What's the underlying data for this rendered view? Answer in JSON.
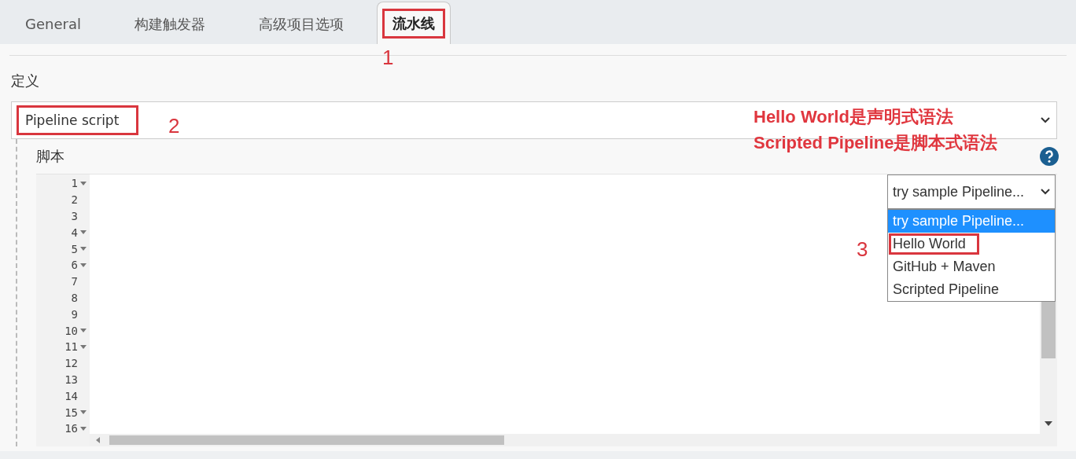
{
  "tabs": [
    {
      "label": "General",
      "selected": false,
      "highlighted": false
    },
    {
      "label": "构建触发器",
      "selected": false,
      "highlighted": false
    },
    {
      "label": "高级项目选项",
      "selected": false,
      "highlighted": false
    },
    {
      "label": "流水线",
      "selected": true,
      "highlighted": true
    }
  ],
  "definition": {
    "label": "定义",
    "value": "Pipeline script",
    "highlighted": true
  },
  "script": {
    "label": "脚本",
    "lines": [
      {
        "number": "1",
        "fold": true
      },
      {
        "number": "2",
        "fold": false
      },
      {
        "number": "3",
        "fold": false
      },
      {
        "number": "4",
        "fold": true
      },
      {
        "number": "5",
        "fold": true
      },
      {
        "number": "6",
        "fold": true
      },
      {
        "number": "7",
        "fold": false
      },
      {
        "number": "8",
        "fold": false
      },
      {
        "number": "9",
        "fold": false
      },
      {
        "number": "10",
        "fold": true
      },
      {
        "number": "11",
        "fold": true
      },
      {
        "number": "12",
        "fold": false
      },
      {
        "number": "13",
        "fold": false
      },
      {
        "number": "14",
        "fold": false
      },
      {
        "number": "15",
        "fold": true
      },
      {
        "number": "16",
        "fold": true
      }
    ],
    "sample_select": {
      "value": "try sample Pipeline...",
      "options": [
        {
          "label": "try sample Pipeline...",
          "selected": true,
          "highlighted": false
        },
        {
          "label": "Hello World",
          "selected": false,
          "highlighted": true
        },
        {
          "label": "GitHub + Maven",
          "selected": false,
          "highlighted": false
        },
        {
          "label": "Scripted Pipeline",
          "selected": false,
          "highlighted": false
        }
      ]
    }
  },
  "annotations": {
    "markers": [
      "1",
      "2",
      "3"
    ],
    "note": [
      "Hello World是声明式语法",
      "Scripted Pipeline是脚本式语法"
    ]
  }
}
